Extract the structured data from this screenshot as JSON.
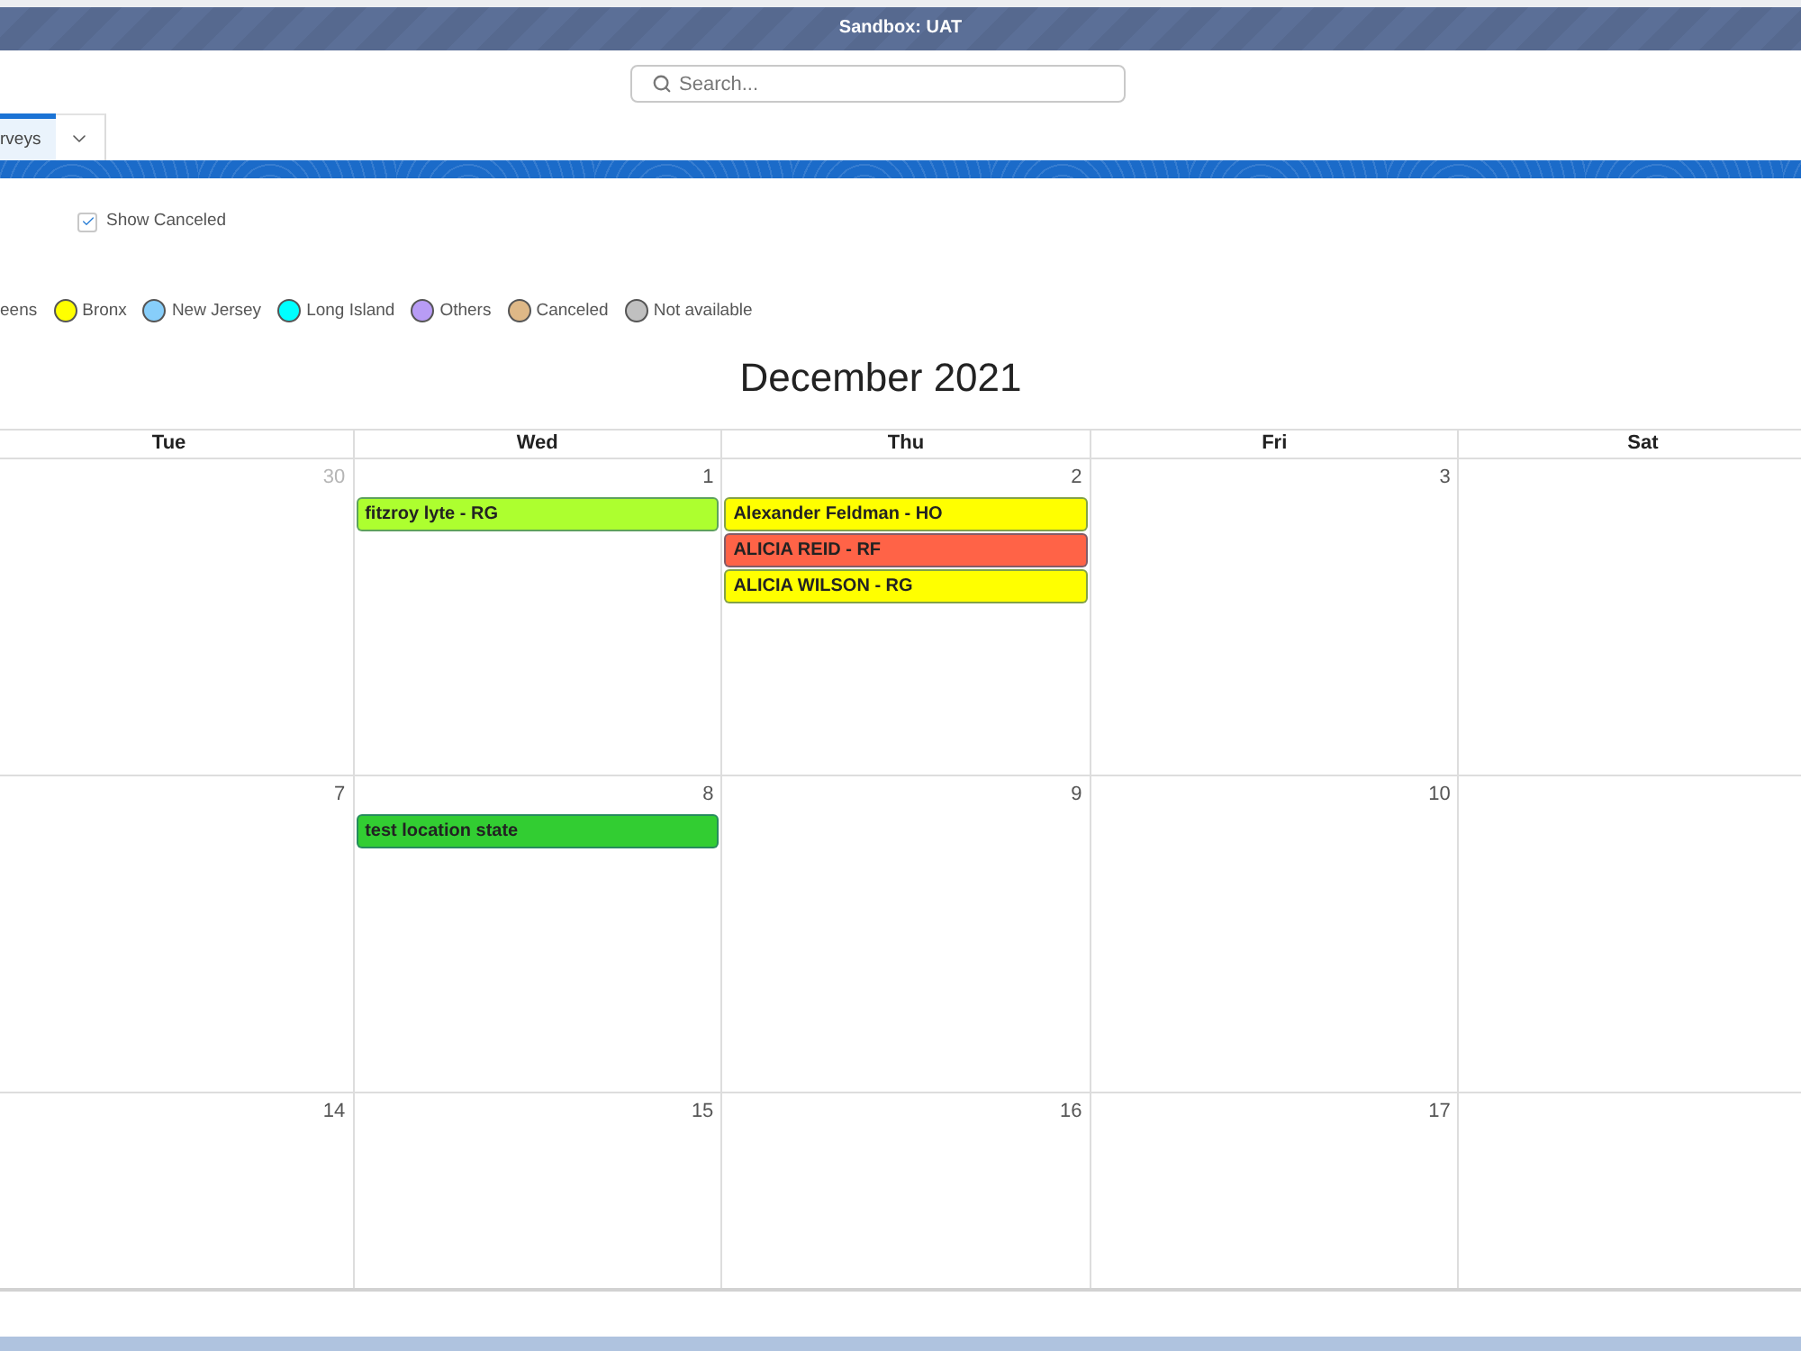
{
  "sandbox_banner": {
    "title": "Sandbox: UAT"
  },
  "search": {
    "placeholder": "Search..."
  },
  "tabs": [
    {
      "label": "rveys",
      "selected": true
    }
  ],
  "more_tabs_menu": true,
  "filters": {
    "show_canceled": {
      "label": "Show Canceled",
      "checked": true
    }
  },
  "legend": [
    {
      "label": "eens"
    },
    {
      "label": "Bronx",
      "color": "#ffff00"
    },
    {
      "label": "New Jersey",
      "color": "#87cefa"
    },
    {
      "label": "Long Island",
      "color": "#00ffff"
    },
    {
      "label": "Others",
      "color": "#b89cf5"
    },
    {
      "label": "Canceled",
      "color": "#deb887"
    },
    {
      "label": "Not available",
      "color": "#c0c0c0"
    }
  ],
  "calendar": {
    "title": "December 2021",
    "weekdays": [
      "Tue",
      "Wed",
      "Thu",
      "Fri",
      "Sat"
    ],
    "weeks": [
      {
        "days": [
          {
            "number": "30",
            "other_month": true
          },
          {
            "number": "1",
            "other_month": false,
            "events": [
              {
                "title": "fitzroy lyte - RG",
                "color": "#adff2f"
              }
            ]
          },
          {
            "number": "2",
            "other_month": false,
            "events": [
              {
                "title": "Alexander Feldman - HO",
                "color": "#ffff00"
              },
              {
                "title": "ALICIA REID - RF",
                "color": "#ff6347"
              },
              {
                "title": "ALICIA WILSON - RG",
                "color": "#ffff00"
              }
            ]
          },
          {
            "number": "3",
            "other_month": false
          }
        ]
      },
      {
        "days": [
          {
            "number": "7",
            "other_month": false
          },
          {
            "number": "8",
            "other_month": false,
            "events": [
              {
                "title": "test location state",
                "color": "#32cd32"
              }
            ]
          },
          {
            "number": "9",
            "other_month": false
          },
          {
            "number": "10",
            "other_month": false
          }
        ]
      },
      {
        "days": [
          {
            "number": "14",
            "other_month": false
          },
          {
            "number": "15",
            "other_month": false
          },
          {
            "number": "16",
            "other_month": false
          },
          {
            "number": "17",
            "other_month": false
          }
        ]
      }
    ]
  }
}
